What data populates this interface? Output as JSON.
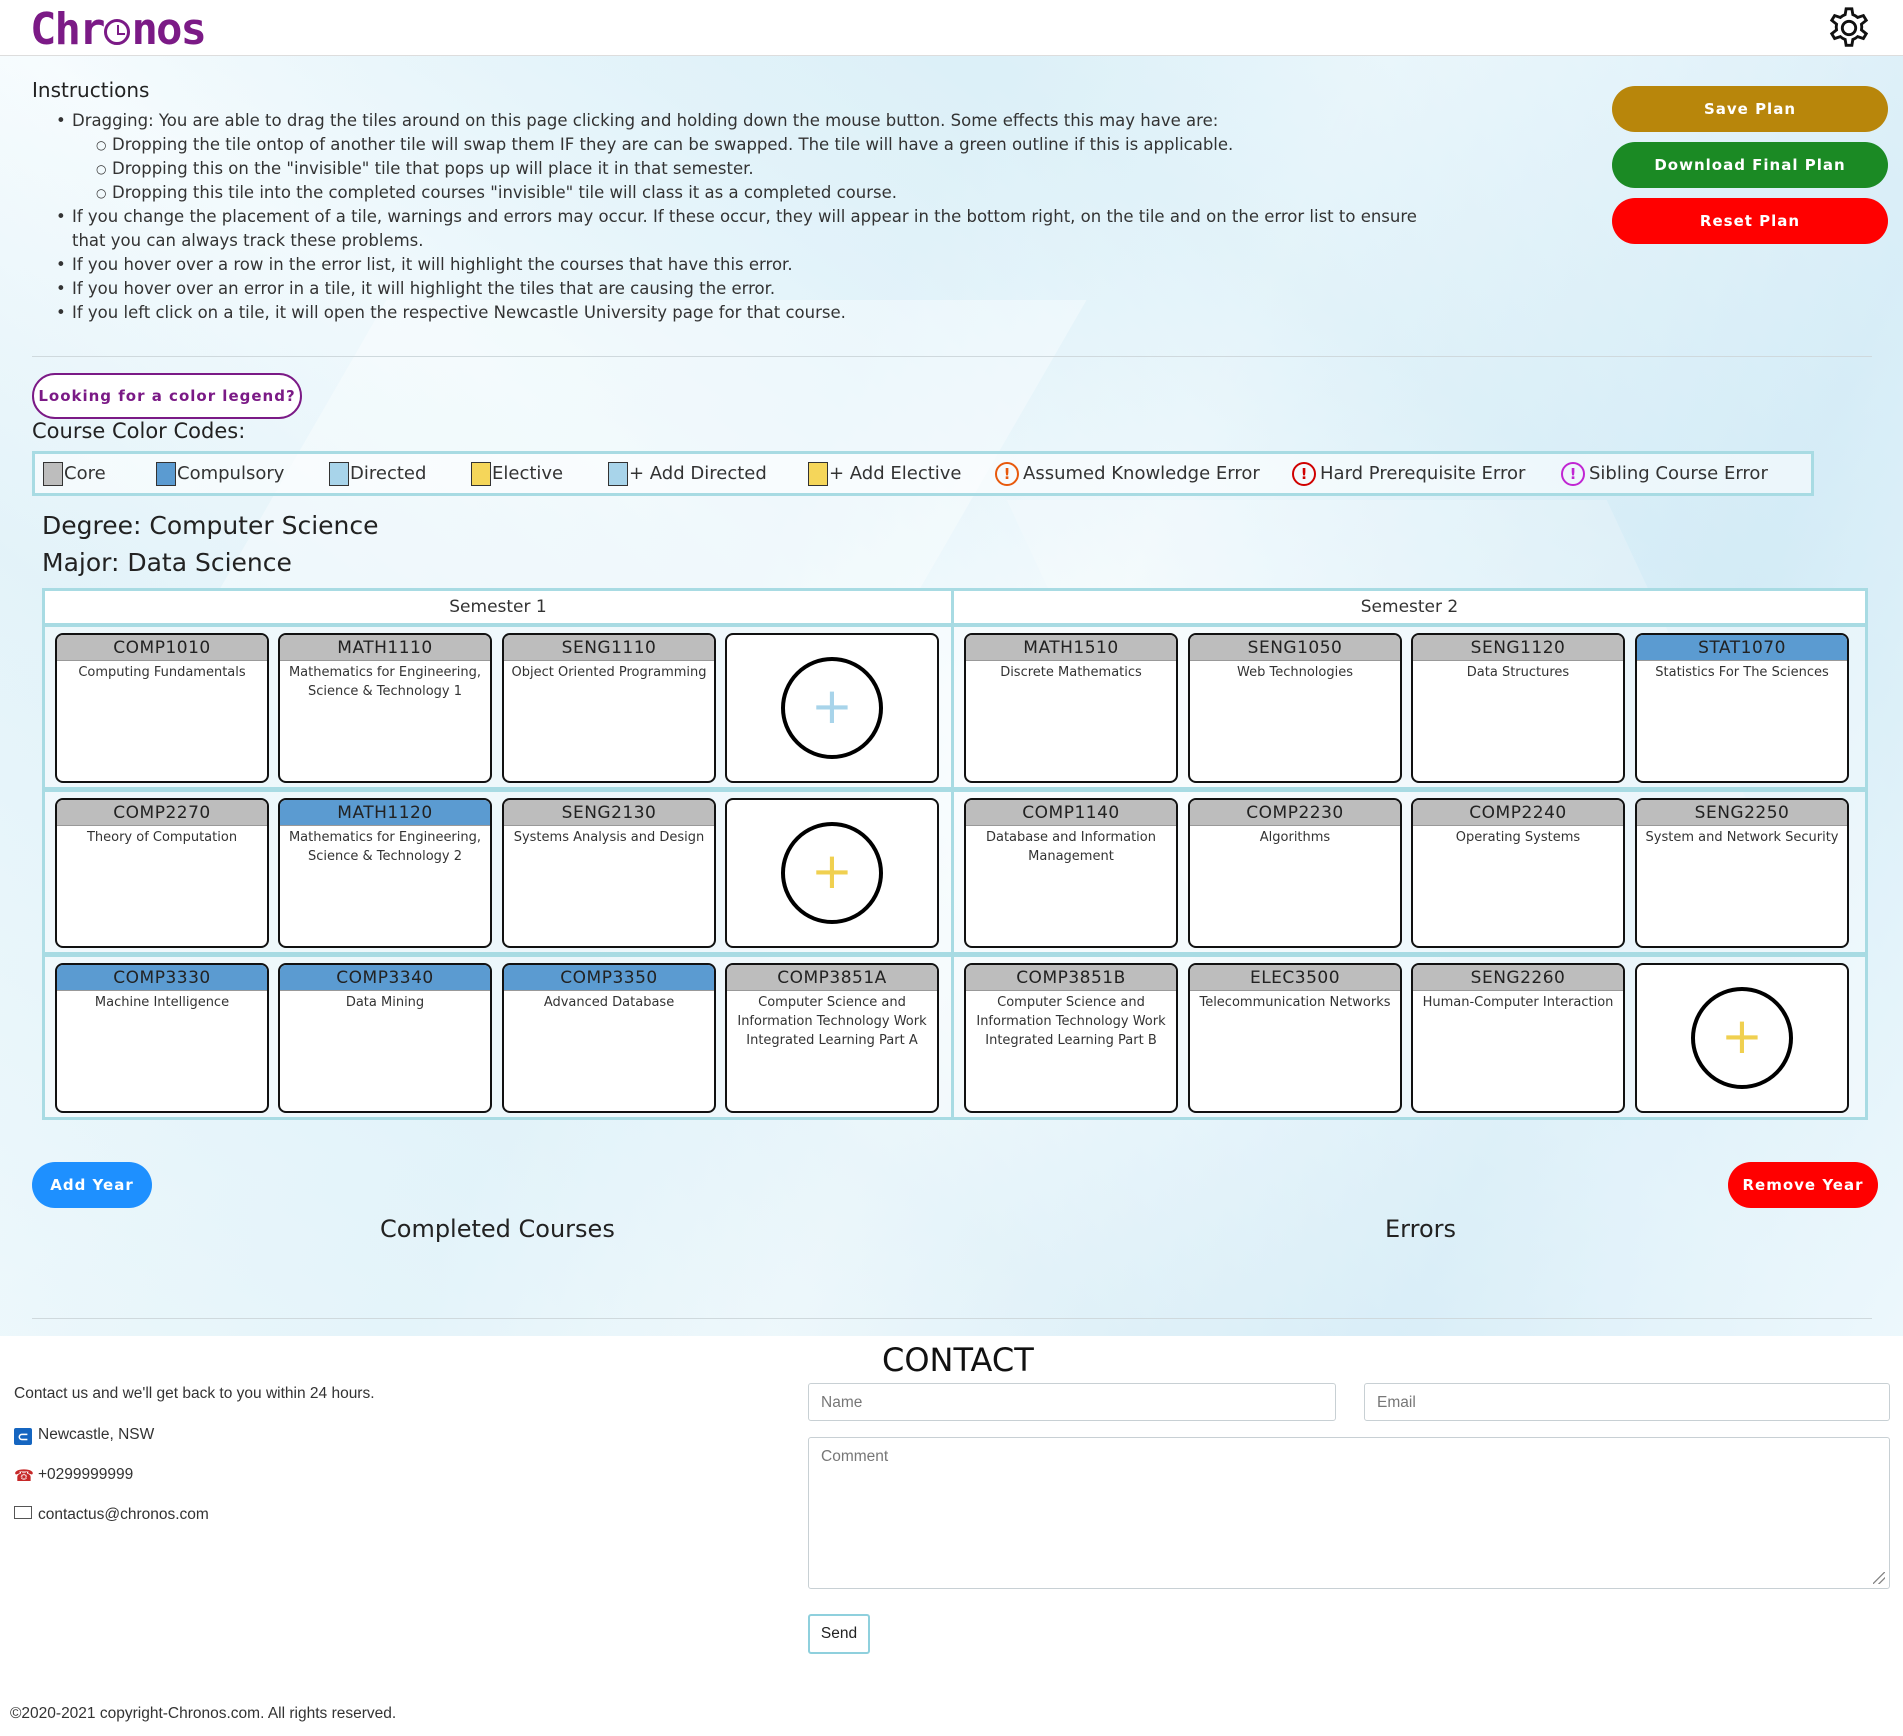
{
  "header": {
    "logo_text_left": "Chr",
    "logo_text_right": "nos"
  },
  "instructions": {
    "title": "Instructions",
    "items": [
      "Dragging: You are able to drag the tiles around on this page clicking and holding down the mouse button. Some effects this may have are:",
      "Dropping the tile ontop of another tile will swap them IF they are can be swapped. The tile will have a green outline if this is applicable.",
      "Dropping this on the \"invisible\" tile that pops up will place it in that semester.",
      "Dropping this tile into the completed courses \"invisible\" tile will class it as a completed course.",
      "If you change the placement of a tile, warnings and errors may occur. If these occur, they will appear in the bottom right, on the tile and on the error list to ensure that you can always track these problems.",
      "If you hover over a row in the error list, it will highlight the courses that have this error.",
      "If you hover over an error in a tile, it will highlight the tiles that are causing the error.",
      "If you left click on a tile, it will open the respective Newcastle University page for that course."
    ]
  },
  "actions": {
    "save": "Save Plan",
    "download": "Download Final Plan",
    "reset": "Reset Plan",
    "legend_toggle": "Looking for a color legend?",
    "add_year": "Add Year",
    "remove_year": "Remove Year"
  },
  "legend": {
    "title": "Course Color Codes:",
    "items": [
      {
        "label": "Core",
        "color": "#bdbdbd"
      },
      {
        "label": "Compulsory",
        "color": "#5b9bd1"
      },
      {
        "label": "Directed",
        "color": "#a8d4ea"
      },
      {
        "label": "Elective",
        "color": "#f5d65a"
      },
      {
        "label": "+ Add Directed",
        "color": "#a8d4ea"
      },
      {
        "label": "+ Add Elective",
        "color": "#f5d65a"
      },
      {
        "label": "Assumed Knowledge Error",
        "color": "#e8590c"
      },
      {
        "label": "Hard Prerequisite Error",
        "color": "#d00000"
      },
      {
        "label": "Sibling Course Error",
        "color": "#c026d3"
      }
    ]
  },
  "degree": {
    "degree_label": "Degree: Computer Science",
    "major_label": "Major: Data Science"
  },
  "plan": {
    "semesters": [
      "Semester 1",
      "Semester 2"
    ],
    "rows": [
      {
        "sem1": [
          {
            "code": "COMP1010",
            "name": "Computing Fundamentals",
            "type": "core"
          },
          {
            "code": "MATH1110",
            "name": "Mathematics for Engineering, Science & Technology 1",
            "type": "core"
          },
          {
            "code": "SENG1110",
            "name": "Object Oriented Programming",
            "type": "core"
          },
          {
            "add": "+",
            "type": "add-directed"
          }
        ],
        "sem2": [
          {
            "code": "MATH1510",
            "name": "Discrete Mathematics",
            "type": "core"
          },
          {
            "code": "SENG1050",
            "name": "Web Technologies",
            "type": "core"
          },
          {
            "code": "SENG1120",
            "name": "Data Structures",
            "type": "core"
          },
          {
            "code": "STAT1070",
            "name": "Statistics For The Sciences",
            "type": "compulsory"
          }
        ]
      },
      {
        "sem1": [
          {
            "code": "COMP2270",
            "name": "Theory of Computation",
            "type": "core"
          },
          {
            "code": "MATH1120",
            "name": "Mathematics for Engineering, Science & Technology 2",
            "type": "compulsory"
          },
          {
            "code": "SENG2130",
            "name": "Systems Analysis and Design",
            "type": "core"
          },
          {
            "add": "+",
            "type": "add-elective"
          }
        ],
        "sem2": [
          {
            "code": "COMP1140",
            "name": "Database and Information Management",
            "type": "core"
          },
          {
            "code": "COMP2230",
            "name": "Algorithms",
            "type": "core"
          },
          {
            "code": "COMP2240",
            "name": "Operating Systems",
            "type": "core"
          },
          {
            "code": "SENG2250",
            "name": "System and Network Security",
            "type": "core"
          }
        ]
      },
      {
        "sem1": [
          {
            "code": "COMP3330",
            "name": "Machine Intelligence",
            "type": "compulsory"
          },
          {
            "code": "COMP3340",
            "name": "Data Mining",
            "type": "compulsory"
          },
          {
            "code": "COMP3350",
            "name": "Advanced Database",
            "type": "compulsory"
          },
          {
            "code": "COMP3851A",
            "name": "Computer Science and Information Technology Work Integrated Learning Part A",
            "type": "core"
          }
        ],
        "sem2": [
          {
            "code": "COMP3851B",
            "name": "Computer Science and Information Technology Work Integrated Learning Part B",
            "type": "core"
          },
          {
            "code": "ELEC3500",
            "name": "Telecommunication Networks",
            "type": "core"
          },
          {
            "code": "SENG2260",
            "name": "Human-Computer Interaction",
            "type": "core"
          },
          {
            "add": "+",
            "type": "add-elective"
          }
        ]
      }
    ]
  },
  "sections": {
    "completed": "Completed Courses",
    "errors": "Errors"
  },
  "contact": {
    "title": "CONTACT",
    "note": "Contact us and we'll get back to you within 24 hours.",
    "location": "Newcastle, NSW",
    "phone": "+0299999999",
    "email": "contactus@chronos.com",
    "name_placeholder": "Name",
    "email_placeholder": "Email",
    "comment_placeholder": "Comment",
    "send": "Send"
  },
  "footer": {
    "copyright": "©2020-2021 copyright-Chronos.com. All rights reserved."
  }
}
